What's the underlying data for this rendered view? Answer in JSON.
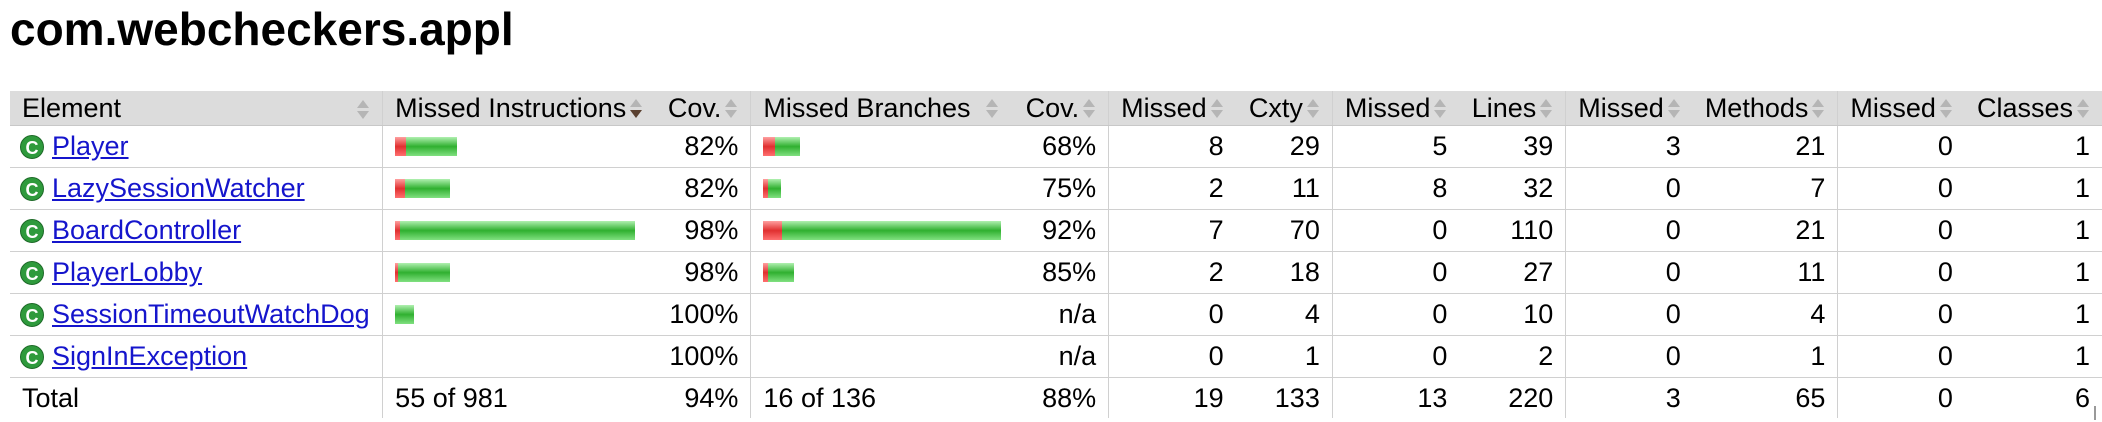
{
  "page": {
    "title": "com.webcheckers.appl"
  },
  "table": {
    "headers": {
      "element": "Element",
      "missed_instructions": "Missed Instructions",
      "cov1": "Cov.",
      "missed_branches": "Missed Branches",
      "cov2": "Cov.",
      "missed_cxty": "Missed",
      "cxty": "Cxty",
      "missed_lines": "Missed",
      "lines": "Lines",
      "missed_methods": "Missed",
      "methods": "Methods",
      "missed_classes": "Missed",
      "classes": "Classes"
    },
    "rows": [
      {
        "name": "Player",
        "instr_missed_frac": 0.18,
        "instr_bar_total_frac": 0.26,
        "cov1": "82%",
        "br_missed_frac": 0.32,
        "br_bar_total_frac": 0.155,
        "cov2": "68%",
        "missed_cxty": "8",
        "cxty": "29",
        "missed_lines": "5",
        "lines": "39",
        "missed_methods": "3",
        "methods": "21",
        "missed_classes": "0",
        "classes": "1"
      },
      {
        "name": "LazySessionWatcher",
        "instr_missed_frac": 0.18,
        "instr_bar_total_frac": 0.23,
        "cov1": "82%",
        "br_missed_frac": 0.25,
        "br_bar_total_frac": 0.075,
        "cov2": "75%",
        "missed_cxty": "2",
        "cxty": "11",
        "missed_lines": "8",
        "lines": "32",
        "missed_methods": "0",
        "methods": "7",
        "missed_classes": "0",
        "classes": "1"
      },
      {
        "name": "BoardController",
        "instr_missed_frac": 0.02,
        "instr_bar_total_frac": 1.0,
        "cov1": "98%",
        "br_missed_frac": 0.08,
        "br_bar_total_frac": 1.0,
        "cov2": "92%",
        "missed_cxty": "7",
        "cxty": "70",
        "missed_lines": "0",
        "lines": "110",
        "missed_methods": "0",
        "methods": "21",
        "missed_classes": "0",
        "classes": "1"
      },
      {
        "name": "PlayerLobby",
        "instr_missed_frac": 0.02,
        "instr_bar_total_frac": 0.23,
        "cov1": "98%",
        "br_missed_frac": 0.15,
        "br_bar_total_frac": 0.13,
        "cov2": "85%",
        "missed_cxty": "2",
        "cxty": "18",
        "missed_lines": "0",
        "lines": "27",
        "missed_methods": "0",
        "methods": "11",
        "missed_classes": "0",
        "classes": "1"
      },
      {
        "name": "SessionTimeoutWatchDog",
        "instr_missed_frac": 0.0,
        "instr_bar_total_frac": 0.08,
        "cov1": "100%",
        "br_missed_frac": 0,
        "br_bar_total_frac": 0,
        "cov2": "n/a",
        "missed_cxty": "0",
        "cxty": "4",
        "missed_lines": "0",
        "lines": "10",
        "missed_methods": "0",
        "methods": "4",
        "missed_classes": "0",
        "classes": "1"
      },
      {
        "name": "SignInException",
        "instr_missed_frac": 0,
        "instr_bar_total_frac": 0,
        "cov1": "100%",
        "br_missed_frac": 0,
        "br_bar_total_frac": 0,
        "cov2": "n/a",
        "missed_cxty": "0",
        "cxty": "1",
        "missed_lines": "0",
        "lines": "2",
        "missed_methods": "0",
        "methods": "1",
        "missed_classes": "0",
        "classes": "1"
      }
    ],
    "total": {
      "label": "Total",
      "instructions": "55 of 981",
      "cov1": "94%",
      "branches": "16 of 136",
      "cov2": "88%",
      "missed_cxty": "19",
      "cxty": "133",
      "missed_lines": "13",
      "lines": "220",
      "missed_methods": "3",
      "methods": "65",
      "missed_classes": "0",
      "classes": "6"
    }
  },
  "icons": {
    "class_icon": "class-c-icon",
    "class_icon_glyph": "C",
    "sort_icon": "sort-arrows-icon"
  },
  "colors": {
    "covered": "#30b030",
    "missed": "#e03030",
    "link": "#1515cc",
    "header_bg": "#dcdcdc"
  }
}
